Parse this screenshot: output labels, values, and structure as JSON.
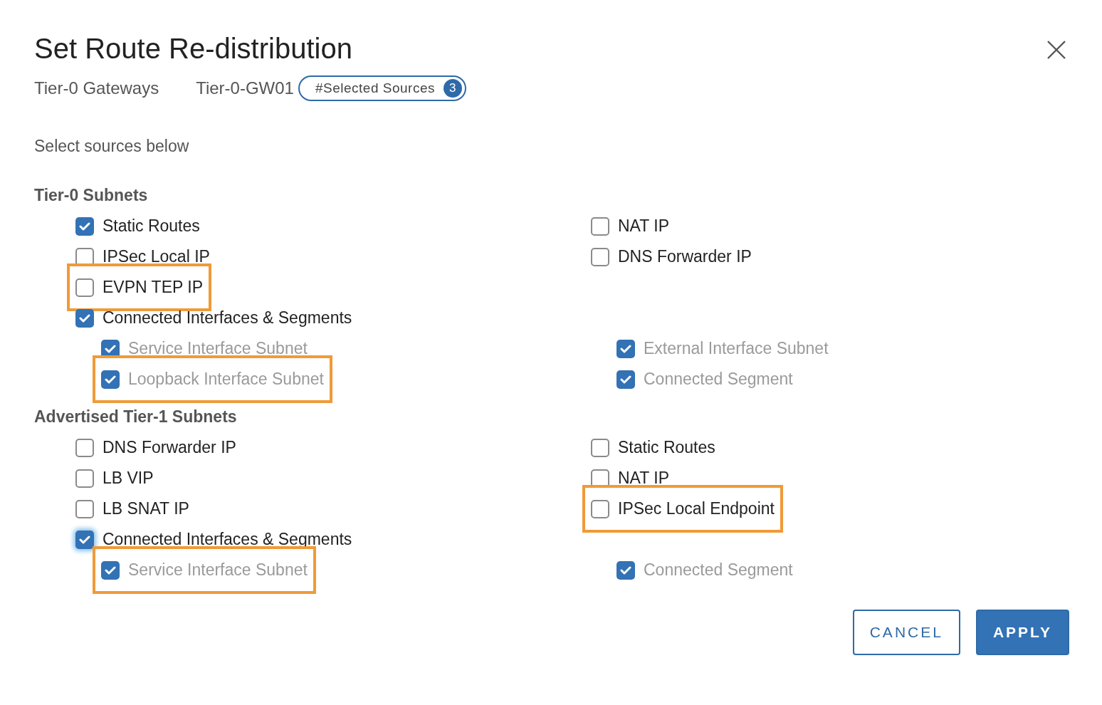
{
  "dialog": {
    "title": "Set Route Re-distribution",
    "breadcrumb": [
      "Tier-0 Gateways",
      "Tier-0-GW01"
    ],
    "badge": {
      "label": "#Selected Sources",
      "count": "3"
    },
    "instruction": "Select sources below"
  },
  "sections": [
    {
      "title": "Tier-0 Subnets",
      "columns": [
        [
          {
            "label": "Static Routes",
            "checked": true,
            "disabled": false,
            "highlighted": false,
            "focused": false
          },
          {
            "label": "IPSec Local IP",
            "checked": false,
            "disabled": false,
            "highlighted": false,
            "focused": false
          },
          {
            "label": "EVPN TEP IP",
            "checked": false,
            "disabled": false,
            "highlighted": true,
            "focused": false
          },
          {
            "label": "Connected Interfaces & Segments",
            "checked": true,
            "disabled": false,
            "highlighted": false,
            "focused": false,
            "children": [
              {
                "label": "Service Interface Subnet",
                "checked": true,
                "disabled": true,
                "highlighted": false,
                "focused": false
              },
              {
                "label": "External Interface Subnet",
                "checked": true,
                "disabled": true,
                "highlighted": false,
                "focused": false
              },
              {
                "label": "Loopback Interface Subnet",
                "checked": true,
                "disabled": true,
                "highlighted": true,
                "focused": false
              },
              {
                "label": "Connected Segment",
                "checked": true,
                "disabled": true,
                "highlighted": false,
                "focused": false
              }
            ]
          }
        ],
        [
          {
            "label": "NAT IP",
            "checked": false,
            "disabled": false,
            "highlighted": false,
            "focused": false
          },
          {
            "label": "DNS Forwarder IP",
            "checked": false,
            "disabled": false,
            "highlighted": false,
            "focused": false
          }
        ]
      ]
    },
    {
      "title": "Advertised Tier-1 Subnets",
      "columns": [
        [
          {
            "label": "DNS Forwarder IP",
            "checked": false,
            "disabled": false,
            "highlighted": false,
            "focused": false
          },
          {
            "label": "LB VIP",
            "checked": false,
            "disabled": false,
            "highlighted": false,
            "focused": false
          },
          {
            "label": "LB SNAT IP",
            "checked": false,
            "disabled": false,
            "highlighted": false,
            "focused": false
          },
          {
            "label": "Connected Interfaces & Segments",
            "checked": true,
            "disabled": false,
            "highlighted": false,
            "focused": true,
            "children": [
              {
                "label": "Service Interface Subnet",
                "checked": true,
                "disabled": true,
                "highlighted": true,
                "focused": false
              },
              {
                "label": "Connected Segment",
                "checked": true,
                "disabled": true,
                "highlighted": false,
                "focused": false
              }
            ]
          }
        ],
        [
          {
            "label": "Static Routes",
            "checked": false,
            "disabled": false,
            "highlighted": false,
            "focused": false
          },
          {
            "label": "NAT IP",
            "checked": false,
            "disabled": false,
            "highlighted": false,
            "focused": false
          },
          {
            "label": "IPSec Local Endpoint",
            "checked": false,
            "disabled": false,
            "highlighted": true,
            "focused": false
          }
        ]
      ]
    }
  ],
  "buttons": [
    {
      "label": "CANCEL",
      "kind": "secondary"
    },
    {
      "label": "APPLY",
      "kind": "primary"
    }
  ]
}
